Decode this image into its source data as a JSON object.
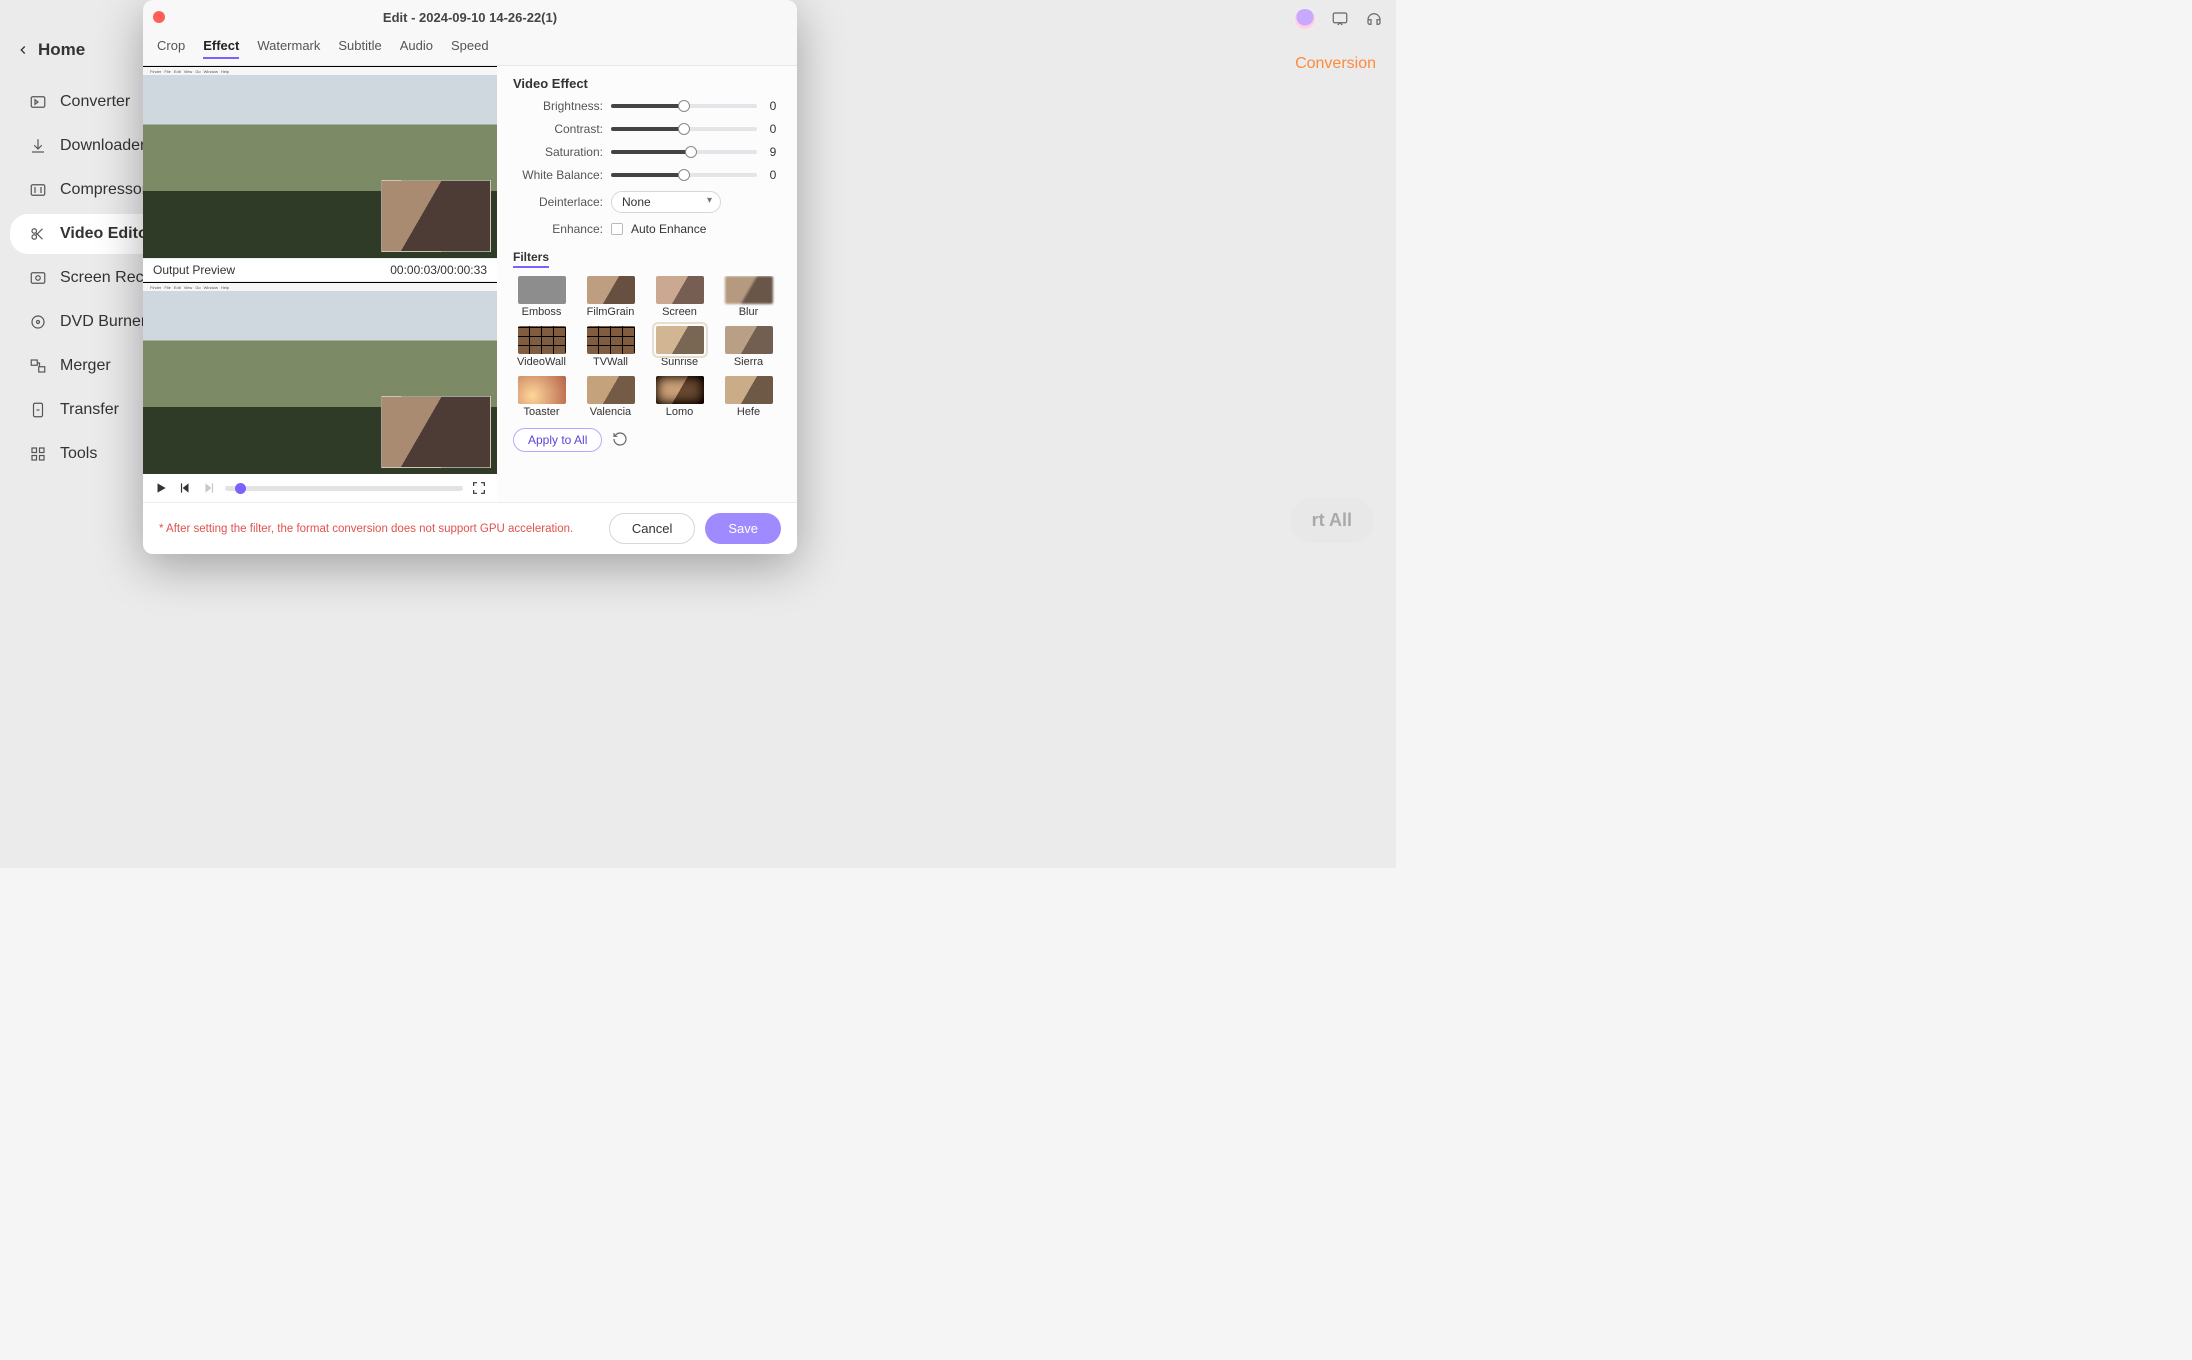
{
  "window": {
    "title": "Edit - 2024-09-10 14-26-22(1)"
  },
  "bg": {
    "conversion": "Conversion",
    "rt_all": "rt  All"
  },
  "sidebar": {
    "home": "Home",
    "items": [
      {
        "icon": "converter-icon",
        "label": "Converter"
      },
      {
        "icon": "downloader-icon",
        "label": "Downloader"
      },
      {
        "icon": "compressor-icon",
        "label": "Compressor"
      },
      {
        "icon": "video-editor-icon",
        "label": "Video Editor",
        "active": true
      },
      {
        "icon": "screen-recorder-icon",
        "label": "Screen Recorder"
      },
      {
        "icon": "dvd-burner-icon",
        "label": "DVD Burner"
      },
      {
        "icon": "merger-icon",
        "label": "Merger"
      },
      {
        "icon": "transfer-icon",
        "label": "Transfer"
      },
      {
        "icon": "tools-icon",
        "label": "Tools"
      }
    ]
  },
  "tabs": [
    {
      "label": "Crop"
    },
    {
      "label": "Effect",
      "active": true
    },
    {
      "label": "Watermark"
    },
    {
      "label": "Subtitle"
    },
    {
      "label": "Audio"
    },
    {
      "label": "Speed"
    }
  ],
  "preview": {
    "label": "Output Preview",
    "time": "00:00:03/00:00:33"
  },
  "effect": {
    "title": "Video Effect",
    "brightness": {
      "label": "Brightness:",
      "value": 0,
      "pct": 50
    },
    "contrast": {
      "label": "Contrast:",
      "value": 0,
      "pct": 50
    },
    "saturation": {
      "label": "Saturation:",
      "value": 9,
      "pct": 55
    },
    "white_balance": {
      "label": "White Balance:",
      "value": 0,
      "pct": 50
    },
    "deinterlace": {
      "label": "Deinterlace:",
      "value": "None"
    },
    "enhance": {
      "label": "Enhance:",
      "option": "Auto Enhance",
      "checked": false
    }
  },
  "filters": {
    "title": "Filters",
    "items": [
      {
        "name": "Emboss"
      },
      {
        "name": "FilmGrain"
      },
      {
        "name": "Screen"
      },
      {
        "name": "Blur"
      },
      {
        "name": "VideoWall"
      },
      {
        "name": "TVWall"
      },
      {
        "name": "Sunrise",
        "selected": true
      },
      {
        "name": "Sierra"
      },
      {
        "name": "Toaster"
      },
      {
        "name": "Valencia"
      },
      {
        "name": "Lomo"
      },
      {
        "name": "Hefe"
      }
    ],
    "apply_all": "Apply to All"
  },
  "footer": {
    "note": "* After setting the filter, the format conversion does not support GPU acceleration.",
    "cancel": "Cancel",
    "save": "Save"
  }
}
